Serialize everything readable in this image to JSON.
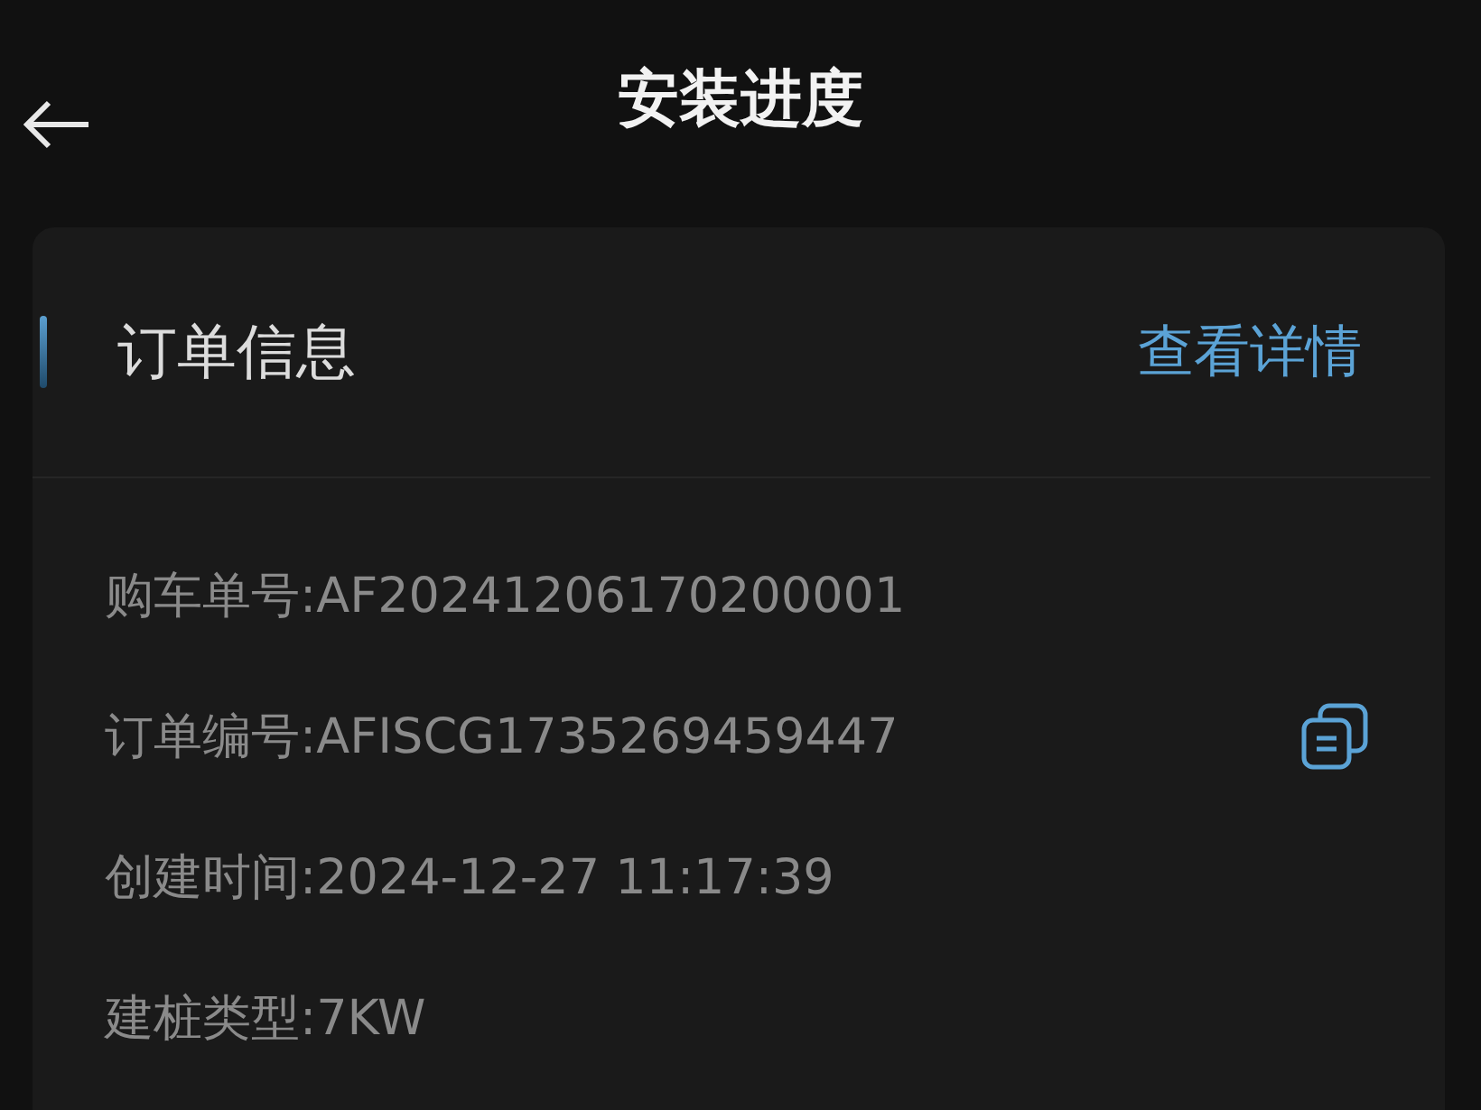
{
  "header": {
    "title": "安装进度"
  },
  "card": {
    "title": "订单信息",
    "link": "查看详情",
    "rows": [
      {
        "text": "购车单号:AF20241206170200001",
        "copyable": false
      },
      {
        "text": "订单编号:AFISCG1735269459447",
        "copyable": true
      },
      {
        "text": "创建时间:2024-12-27 11:17:39",
        "copyable": false
      },
      {
        "text": "建桩类型:7KW",
        "copyable": false
      }
    ]
  }
}
